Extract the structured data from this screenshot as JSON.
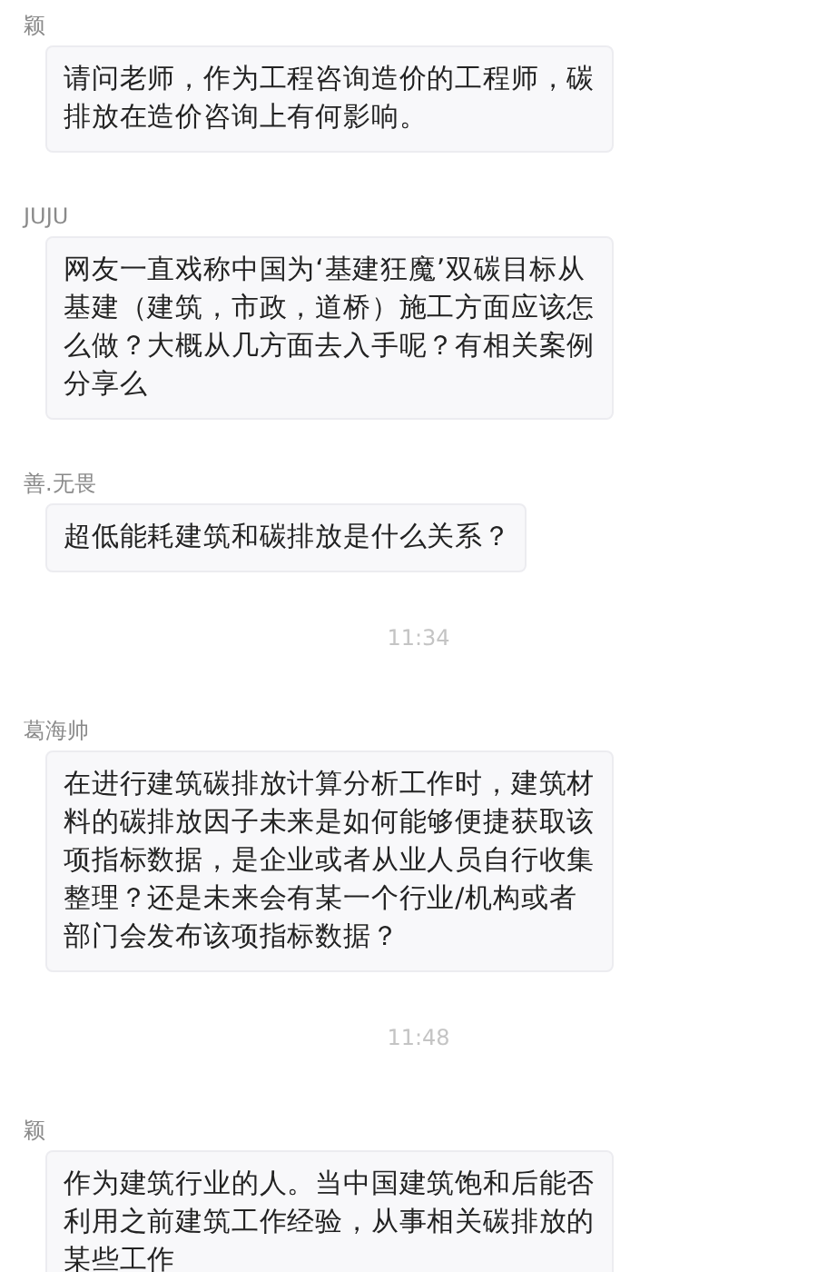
{
  "messages": [
    {
      "kind": "message",
      "sender": "颖",
      "text": "请问老师，作为工程咨询造价的工程师，碳排放在造价咨询上有何影响。"
    },
    {
      "kind": "message",
      "sender": "JUJU",
      "text": "网友一直戏称中国为‘基建狂魔’双碳目标从基建（建筑，市政，道桥）施工方面应该怎么做？大概从几方面去入手呢？有相关案例分享么"
    },
    {
      "kind": "message",
      "sender": "善.无畏",
      "text": "超低能耗建筑和碳排放是什么关系？"
    },
    {
      "kind": "time",
      "text": "11:34"
    },
    {
      "kind": "message",
      "sender": "葛海帅",
      "text": "在进行建筑碳排放计算分析工作时，建筑材料的碳排放因子未来是如何能够便捷获取该项指标数据，是企业或者从业人员自行收集整理？还是未来会有某一个行业/机构或者部门会发布该项指标数据？"
    },
    {
      "kind": "time",
      "text": "11:48"
    },
    {
      "kind": "message",
      "sender": "颖",
      "text": "作为建筑行业的人。当中国建筑饱和后能否利用之前建筑工作经验，从事相关碳排放的某些工作"
    }
  ]
}
